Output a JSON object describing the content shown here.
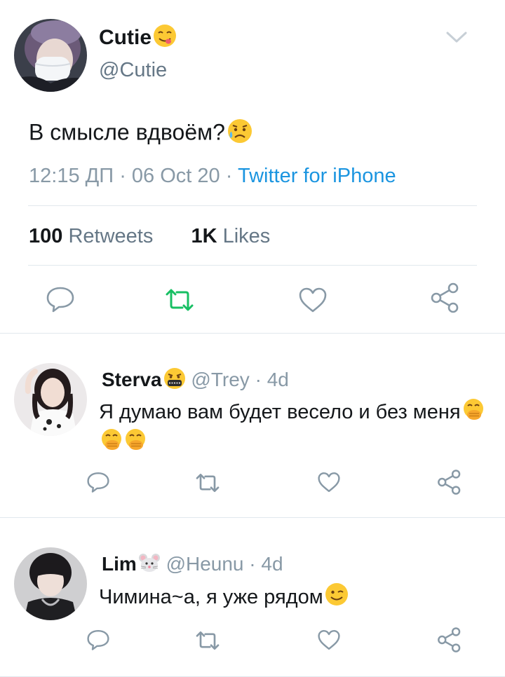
{
  "main_tweet": {
    "name": "Cutie",
    "name_emoji": "yum-face-emoji",
    "handle": "@Cutie",
    "text": "В смысле вдвоём?",
    "text_emoji": "sad-sweat-face-emoji",
    "time": "12:15 ДП",
    "sep1": "·",
    "date": "06 Oct 20",
    "sep2": "·",
    "source": "Twitter for iPhone",
    "retweets_count": "100",
    "retweets_label": "Retweets",
    "likes_count": "1K",
    "likes_label": "Likes"
  },
  "replies": [
    {
      "name": "Sterva",
      "name_emoji": "cursing-face-emoji",
      "handle": "@Trey",
      "sep": "·",
      "age": "4d",
      "text": "Я думаю вам будет весело и без меня",
      "text_emojis": [
        "hand-over-mouth-emoji",
        "hand-over-mouth-emoji",
        "hand-over-mouth-emoji"
      ]
    },
    {
      "name": "Lim",
      "name_emoji": "mouse-face-emoji",
      "handle": "@Heunu",
      "sep": "·",
      "age": "4d",
      "text": "Чимина~а, я уже рядом",
      "text_emoji": "winking-face-emoji"
    }
  ],
  "colors": {
    "text": "#14171a",
    "secondary": "#657786",
    "link": "#1b95e0",
    "retweet_active": "#17bf63",
    "icon": "#8899a6",
    "divider": "#e1e8ed"
  },
  "icons": [
    "reply-icon",
    "retweet-icon",
    "like-icon",
    "share-icon",
    "chevron-down-icon"
  ]
}
